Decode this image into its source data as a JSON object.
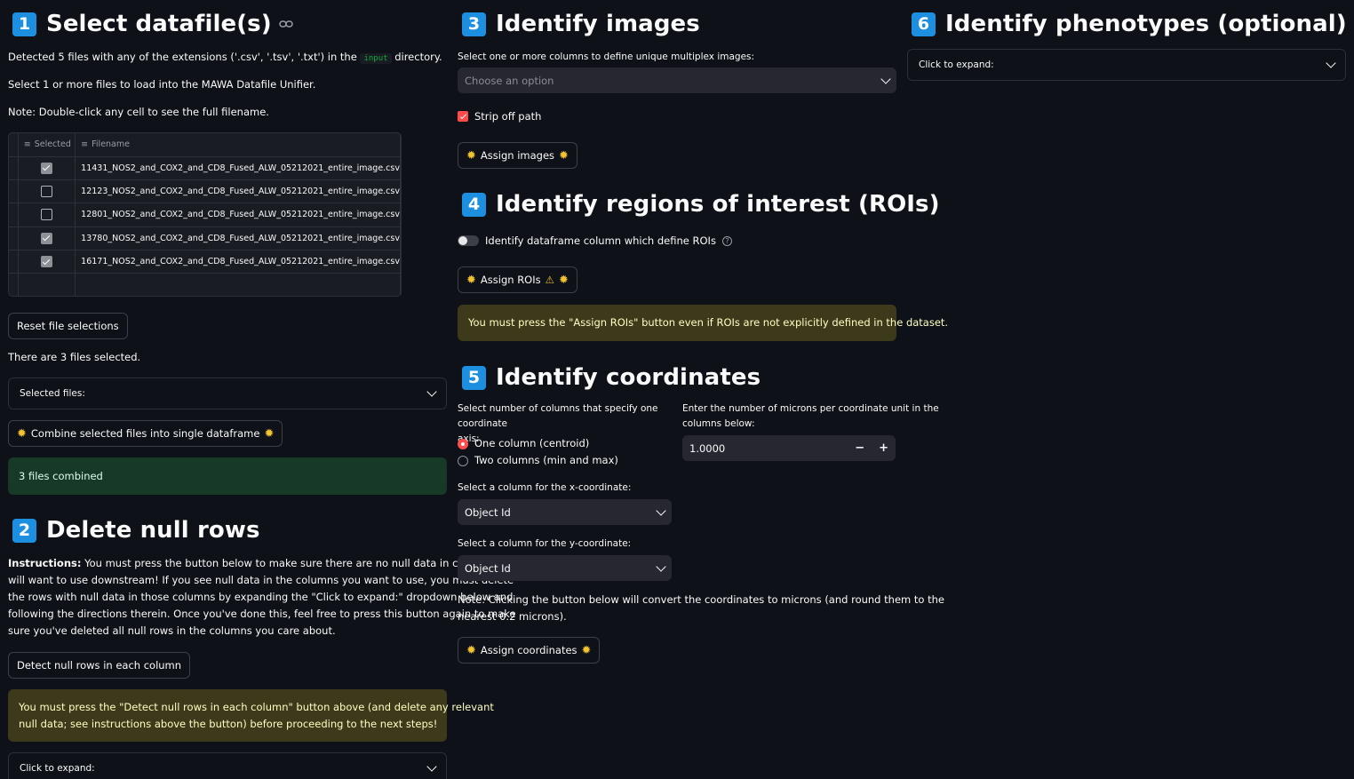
{
  "section1": {
    "number": "1",
    "title": "Select datafile(s)",
    "detected_prefix": "Detected 5 files with any of the extensions ('.csv', '.tsv', '.txt') in the",
    "detected_code": "input",
    "detected_suffix": "directory.",
    "select_note": "Select 1 or more files to load into the MAWA Datafile Unifier.",
    "dbl_note": "Note: Double-click any cell to see the full filename.",
    "table": {
      "col_selected": "Selected",
      "col_filename": "Filename",
      "rows": [
        {
          "selected": true,
          "filename": "11431_NOS2_and_COX2_and_CD8_Fused_ALW_05212021_entire_image.csv"
        },
        {
          "selected": false,
          "filename": "12123_NOS2_and_COX2_and_CD8_Fused_ALW_05212021_entire_image.csv"
        },
        {
          "selected": false,
          "filename": "12801_NOS2_and_COX2_and_CD8_Fused_ALW_05212021_entire_image.csv"
        },
        {
          "selected": true,
          "filename": "13780_NOS2_and_COX2_and_CD8_Fused_ALW_05212021_entire_image.csv"
        },
        {
          "selected": true,
          "filename": "16171_NOS2_and_COX2_and_CD8_Fused_ALW_05212021_entire_image.csv"
        }
      ]
    },
    "reset_label": "Reset file selections",
    "count_text": "There are 3 files selected.",
    "selected_files_expander": "Selected files:",
    "combine_label": "Combine selected files into single dataframe",
    "combined_msg": "3 files combined"
  },
  "section2": {
    "number": "2",
    "title": "Delete null rows",
    "instructions_bold": "Instructions:",
    "instructions_lines": [
      " You must press the button below to make sure there are no null data in columns you",
      "will want to use downstream! If you see null data in the columns you want to use, you must delete",
      "the rows with null data in those columns by expanding the \"Click to expand:\" dropdown below and",
      "following the directions therein. Once you've done this, feel free to press this button again to make",
      "sure you've deleted all null rows in the columns you care about."
    ],
    "detect_label": "Detect null rows in each column",
    "warning_lines": [
      "You must press the \"Detect null rows in each column\" button above (and delete any relevant",
      "null data; see instructions above the button) before proceeding to the next steps!"
    ],
    "expander": "Click to expand:"
  },
  "section3": {
    "number": "3",
    "title": "Identify images",
    "label": "Select one or more columns to define unique multiplex images:",
    "placeholder": "Choose an option",
    "strip_label": "Strip off path",
    "assign_label": "Assign images"
  },
  "section4": {
    "number": "4",
    "title": "Identify regions of interest (ROIs)",
    "toggle_label": "Identify dataframe column which define ROIs",
    "help_icon": "?",
    "assign_label": "Assign ROIs",
    "warn_icon": "⚠",
    "warning": "You must press the \"Assign ROIs\" button even if ROIs are not explicitly defined in the dataset."
  },
  "section5": {
    "number": "5",
    "title": "Identify coordinates",
    "cols_label_1": "Select number of columns that specify one coordinate",
    "cols_label_2": "axis:",
    "radio_one": "One column (centroid)",
    "radio_two": "Two columns (min and max)",
    "microns_label_1": "Enter the number of microns per coordinate unit in the",
    "microns_label_2": "columns below:",
    "microns_value": "1.0000",
    "minus": "−",
    "plus": "+",
    "x_label": "Select a column for the x-coordinate:",
    "x_value": "Object Id",
    "y_label": "Select a column for the y-coordinate:",
    "y_value": "Object Id",
    "note_1": "Note: Clicking the button below will convert the coordinates to microns (and round them to the",
    "note_2": "nearest 0.2 microns).",
    "assign_label": "Assign coordinates"
  },
  "section6": {
    "number": "6",
    "title": "Identify phenotypes (optional)",
    "expander": "Click to expand:"
  },
  "icons": {
    "sun": "✹",
    "link": "⛓"
  },
  "colors": {
    "accent_blue": "#1d8fe1",
    "success_bg": "#173928",
    "warning_bg": "#3c3a1a",
    "radio_red": "#ff4b4b"
  }
}
